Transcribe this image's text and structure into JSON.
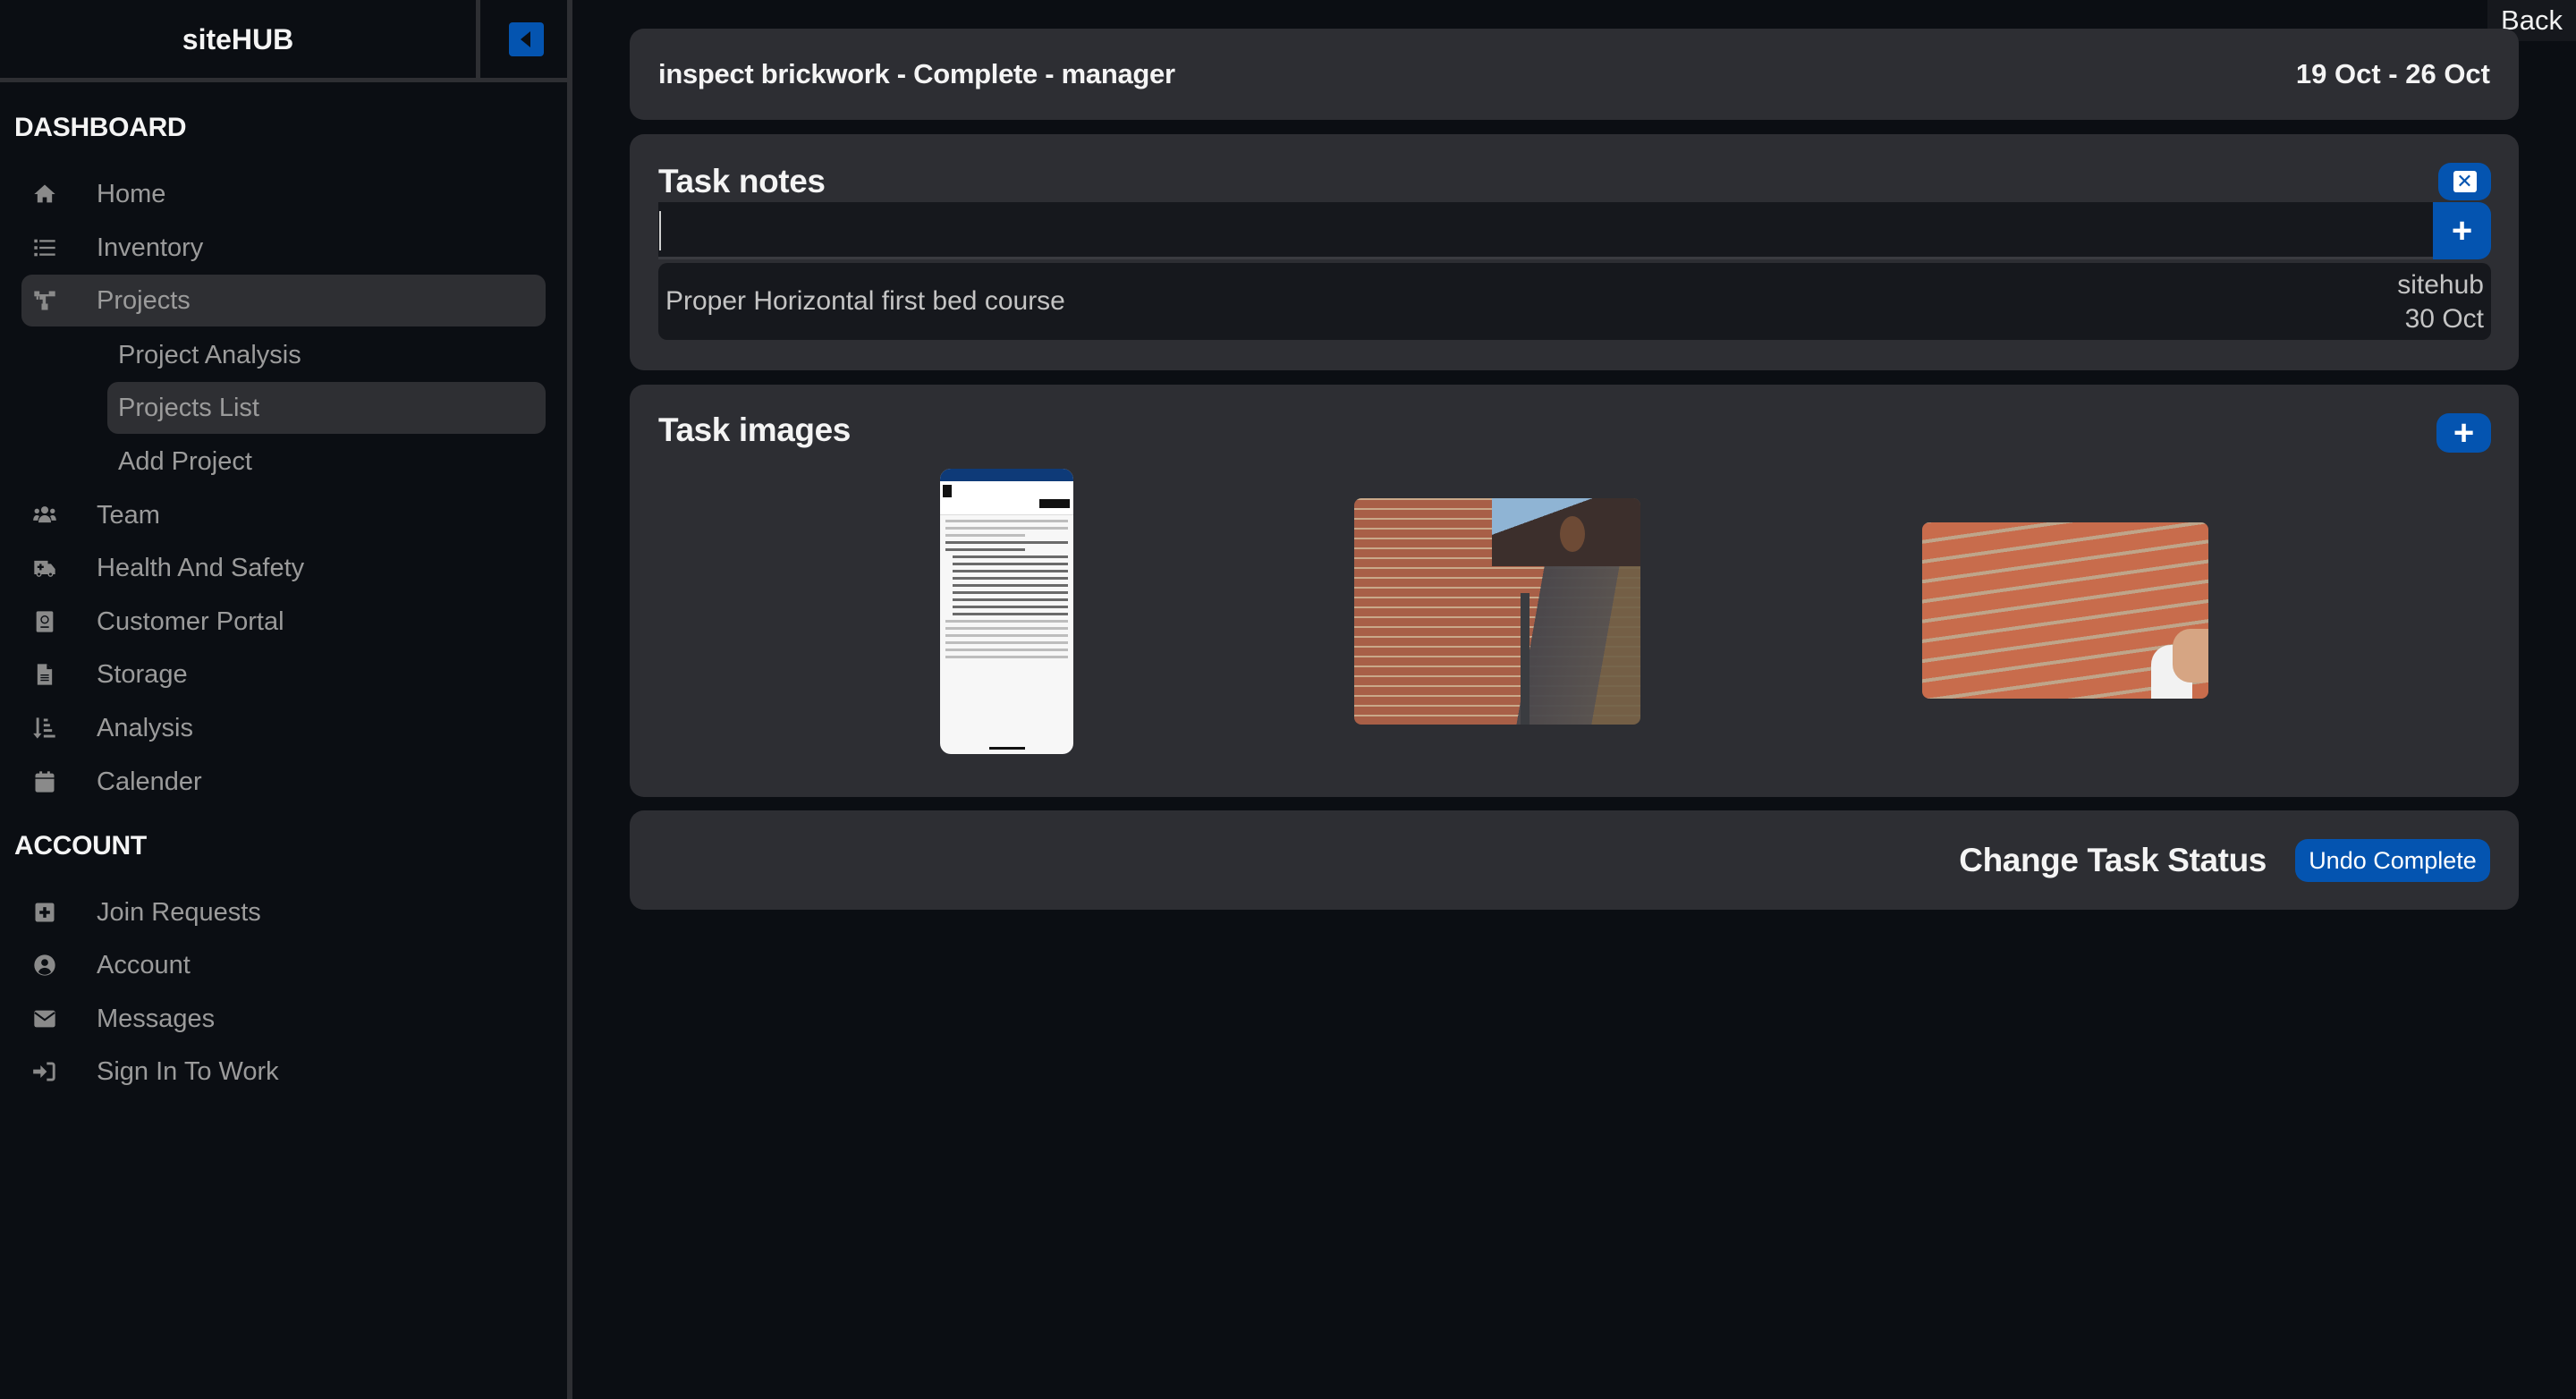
{
  "sidebar": {
    "brand": "siteHUB",
    "toggle_icon": "caret-left-icon",
    "sections": {
      "dashboard": "DASHBOARD",
      "account": "ACCOUNT"
    },
    "items": [
      {
        "label": "Home",
        "icon": "home-icon"
      },
      {
        "label": "Inventory",
        "icon": "list-icon"
      },
      {
        "label": "Projects",
        "icon": "sitemap-icon",
        "active": true
      },
      {
        "label": "Team",
        "icon": "users-icon"
      },
      {
        "label": "Health And Safety",
        "icon": "ambulance-icon"
      },
      {
        "label": "Customer Portal",
        "icon": "passport-icon"
      },
      {
        "label": "Storage",
        "icon": "file-icon"
      },
      {
        "label": "Analysis",
        "icon": "sort-amount-down-icon"
      },
      {
        "label": "Calender",
        "icon": "calendar-icon"
      }
    ],
    "sub_items": [
      {
        "label": "Project Analysis"
      },
      {
        "label": "Projects List",
        "active": true
      },
      {
        "label": "Add Project"
      }
    ],
    "account_items": [
      {
        "label": "Join Requests",
        "icon": "plus-square-icon"
      },
      {
        "label": "Account",
        "icon": "user-circle-icon"
      },
      {
        "label": "Messages",
        "icon": "envelope-icon"
      },
      {
        "label": "Sign In To Work",
        "icon": "sign-in-icon"
      }
    ]
  },
  "header": {
    "back_label": "Back"
  },
  "task": {
    "title": "inspect brickwork - Complete - manager",
    "date_range": "19 Oct - 26 Oct"
  },
  "notes": {
    "title": "Task notes",
    "input_value": "",
    "input_placeholder": "",
    "clear_icon": "close-square-icon",
    "add_icon": "plus-icon",
    "entries": [
      {
        "text": "Proper Horizontal first bed course",
        "author": "sitehub",
        "date": "30 Oct"
      }
    ]
  },
  "images": {
    "title": "Task images",
    "add_icon": "plus-icon",
    "items": [
      {
        "alt": "Phone screenshot of construction forecast article"
      },
      {
        "alt": "Man inspecting brick wall under roof gutter"
      },
      {
        "alt": "Hand spraying brick wall"
      }
    ]
  },
  "status": {
    "label": "Change Task Status",
    "button": "Undo Complete"
  },
  "colors": {
    "accent": "#0454b0",
    "background": "#0b0e13",
    "card": "#2d2e33",
    "input": "#16181d"
  }
}
